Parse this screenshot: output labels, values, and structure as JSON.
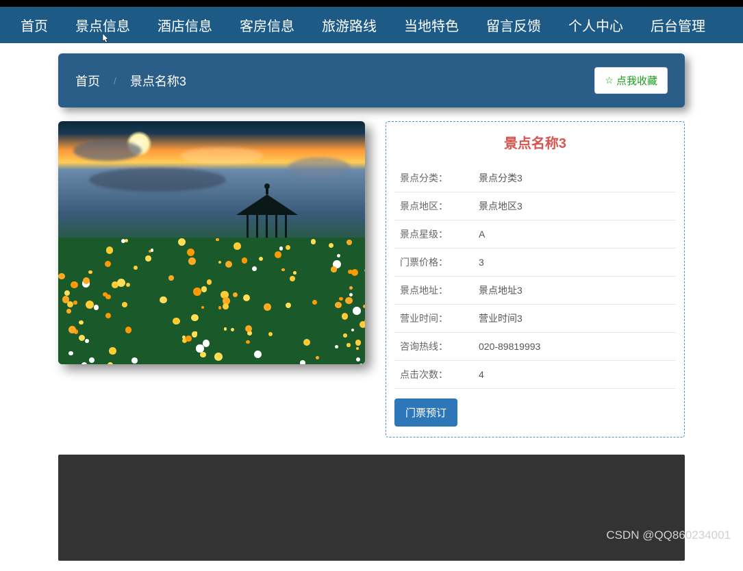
{
  "nav": {
    "items": [
      {
        "label": "首页"
      },
      {
        "label": "景点信息"
      },
      {
        "label": "酒店信息"
      },
      {
        "label": "客房信息"
      },
      {
        "label": "旅游路线"
      },
      {
        "label": "当地特色"
      },
      {
        "label": "留言反馈"
      },
      {
        "label": "个人中心"
      },
      {
        "label": "后台管理"
      }
    ]
  },
  "breadcrumb": {
    "home": "首页",
    "sep": "/",
    "current": "景点名称3"
  },
  "favorite_label": "点我收藏",
  "detail": {
    "title": "景点名称3",
    "rows": [
      {
        "label": "景点分类：",
        "value": "景点分类3"
      },
      {
        "label": "景点地区：",
        "value": "景点地区3"
      },
      {
        "label": "景点星级：",
        "value": "A"
      },
      {
        "label": "门票价格：",
        "value": "3"
      },
      {
        "label": "景点地址：",
        "value": "景点地址3"
      },
      {
        "label": "营业时间：",
        "value": "营业时间3"
      },
      {
        "label": "咨询热线：",
        "value": "020-89819993"
      },
      {
        "label": "点击次数：",
        "value": "4"
      }
    ],
    "book_label": "门票预订"
  },
  "watermark": "CSDN @QQ860234001"
}
